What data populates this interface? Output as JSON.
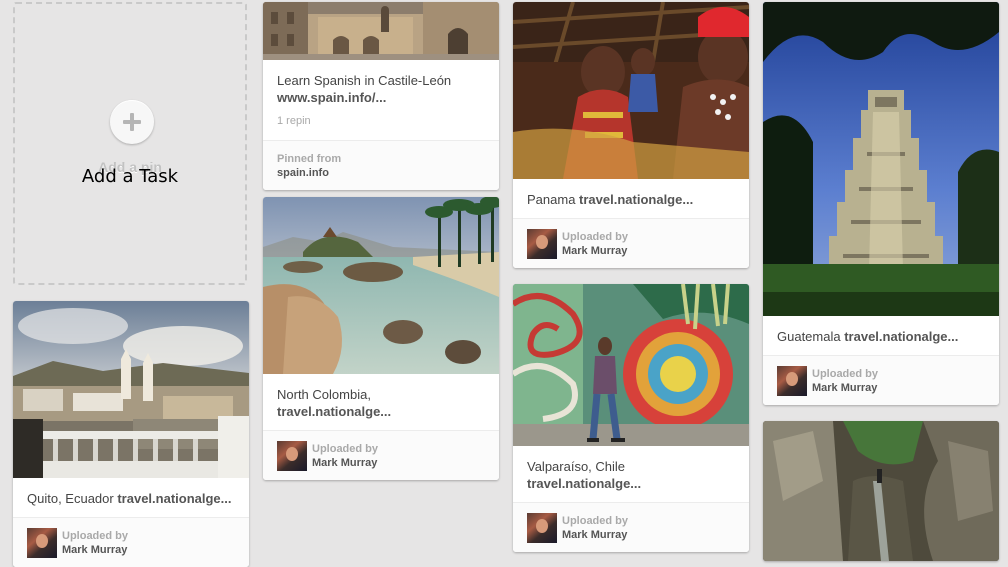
{
  "add_card": {
    "ghost_label": "Add a pin",
    "task_label": "Add a Task"
  },
  "pins": {
    "spain": {
      "title": "Learn Spanish in Castile-León",
      "link": "www.spain.info/...",
      "repins": "1 repin",
      "pinned_label": "Pinned from",
      "source": "spain.info"
    },
    "quito": {
      "title": "Quito, Ecuador",
      "link": "travel.nationalge...",
      "uploaded_label": "Uploaded by",
      "user": "Mark Murray"
    },
    "colombia": {
      "title": "North Colombia,",
      "link": "travel.nationalge...",
      "uploaded_label": "Uploaded by",
      "user": "Mark Murray"
    },
    "panama": {
      "title": "Panama",
      "link": "travel.nationalge...",
      "uploaded_label": "Uploaded by",
      "user": "Mark Murray"
    },
    "valparaiso": {
      "title": "Valparaíso, Chile",
      "link": "travel.nationalge...",
      "uploaded_label": "Uploaded by",
      "user": "Mark Murray"
    },
    "guatemala": {
      "title": "Guatemala",
      "link": "travel.nationalge...",
      "uploaded_label": "Uploaded by",
      "user": "Mark Murray"
    }
  }
}
